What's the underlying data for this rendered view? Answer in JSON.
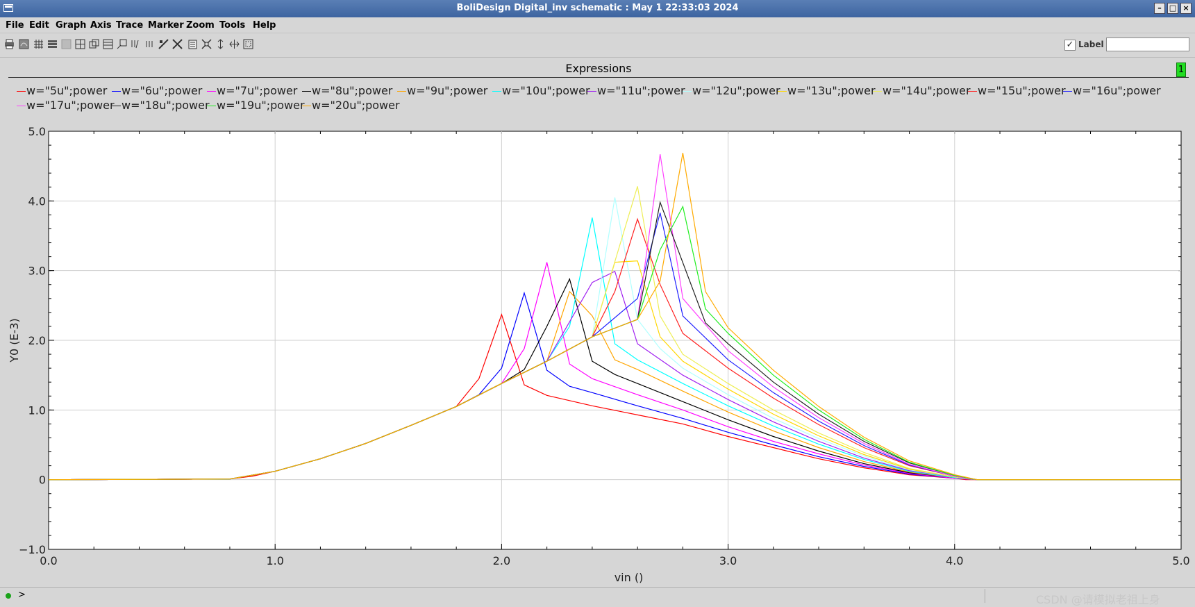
{
  "window": {
    "title": "BoliDesign Digital_inv schematic : May  1 22:33:03 2024",
    "minimize": "–",
    "maximize": "□",
    "close": "×"
  },
  "menubar": {
    "items": [
      "File",
      "Edit",
      "Graph",
      "Axis",
      "Trace",
      "Marker",
      "Zoom",
      "Tools",
      "Help"
    ]
  },
  "toolbar": {
    "icons": [
      "print-icon",
      "calculator-icon",
      "grid-icon",
      "strips-icon",
      "blank-icon",
      "split-icon",
      "overlay-icon",
      "stack-icon",
      "snap-icon",
      "text-icon",
      "columns-icon",
      "bar-icon",
      "fit-icon",
      "clipboard-icon",
      "zoom-fit-icon",
      "pan-icon",
      "move-icon",
      "zoom-box-icon"
    ],
    "label_checked": true,
    "label_text": "Label",
    "label_value": ""
  },
  "panel": {
    "title": "Expressions",
    "badge": "1"
  },
  "chart_data": {
    "type": "line",
    "xlabel": "vin ()",
    "ylabel": "Y0 (E-3)",
    "xlim": [
      0,
      5
    ],
    "ylim": [
      -1,
      5
    ],
    "xticks": [
      "0.0",
      "1.0",
      "2.0",
      "3.0",
      "4.0",
      "5.0"
    ],
    "yticks": [
      "−1.0",
      "0",
      "1.0",
      "2.0",
      "3.0",
      "4.0",
      "5.0"
    ],
    "grid": true,
    "legend_position": "top",
    "series": [
      {
        "name": "w=\"5u\";power",
        "color": "#ff0000",
        "x": [
          0,
          0.8,
          0.9,
          1.0,
          1.2,
          1.4,
          1.6,
          1.8,
          1.9,
          2.0,
          2.1,
          2.2,
          2.4,
          2.6,
          2.8,
          3.0,
          3.2,
          3.4,
          3.6,
          3.8,
          4.0,
          4.05,
          5.0
        ],
        "y": [
          0,
          0.01,
          0.05,
          0.12,
          0.3,
          0.52,
          0.78,
          1.05,
          1.45,
          2.37,
          1.36,
          1.21,
          1.06,
          0.93,
          0.8,
          0.62,
          0.46,
          0.3,
          0.17,
          0.07,
          0.02,
          0,
          0
        ]
      },
      {
        "name": "w=\"6u\";power",
        "color": "#0000ff",
        "x": [
          0,
          0.8,
          1.0,
          1.2,
          1.4,
          1.6,
          1.8,
          1.9,
          2.0,
          2.1,
          2.2,
          2.3,
          2.4,
          2.6,
          2.8,
          3.0,
          3.2,
          3.4,
          3.6,
          3.8,
          4.0,
          4.1,
          5.0
        ],
        "y": [
          0,
          0.01,
          0.12,
          0.3,
          0.52,
          0.78,
          1.05,
          1.22,
          1.6,
          2.68,
          1.57,
          1.34,
          1.25,
          1.06,
          0.88,
          0.68,
          0.5,
          0.33,
          0.19,
          0.08,
          0.02,
          0,
          0
        ]
      },
      {
        "name": "w=\"7u\";power",
        "color": "#ff00ff",
        "x": [
          0,
          0.8,
          1.0,
          1.2,
          1.4,
          1.6,
          1.8,
          2.0,
          2.1,
          2.2,
          2.3,
          2.4,
          2.6,
          2.8,
          3.0,
          3.2,
          3.4,
          3.6,
          3.8,
          4.0,
          4.1,
          5.0
        ],
        "y": [
          0,
          0.01,
          0.12,
          0.3,
          0.52,
          0.78,
          1.05,
          1.38,
          1.88,
          3.12,
          1.66,
          1.45,
          1.22,
          1.0,
          0.76,
          0.55,
          0.37,
          0.21,
          0.09,
          0.02,
          0,
          0
        ]
      },
      {
        "name": "w=\"8u\";power",
        "color": "#000000",
        "x": [
          0,
          0.8,
          1.0,
          1.2,
          1.4,
          1.6,
          1.8,
          2.0,
          2.1,
          2.2,
          2.3,
          2.4,
          2.5,
          2.6,
          2.8,
          3.0,
          3.2,
          3.4,
          3.6,
          3.8,
          4.0,
          4.1,
          5.0
        ],
        "y": [
          0,
          0.01,
          0.12,
          0.3,
          0.52,
          0.78,
          1.05,
          1.38,
          1.58,
          2.2,
          2.88,
          1.7,
          1.51,
          1.38,
          1.12,
          0.86,
          0.62,
          0.41,
          0.23,
          0.1,
          0.03,
          0,
          0
        ]
      },
      {
        "name": "w=\"9u\";power",
        "color": "#ffa500",
        "x": [
          0,
          0.8,
          1.0,
          1.2,
          1.4,
          1.6,
          1.8,
          2.0,
          2.2,
          2.3,
          2.4,
          2.5,
          2.6,
          2.8,
          3.0,
          3.2,
          3.4,
          3.6,
          3.8,
          4.0,
          4.1,
          5.0
        ],
        "y": [
          0,
          0.01,
          0.12,
          0.3,
          0.52,
          0.78,
          1.05,
          1.38,
          1.7,
          2.7,
          2.35,
          1.72,
          1.58,
          1.27,
          0.97,
          0.7,
          0.46,
          0.26,
          0.11,
          0.03,
          0,
          0
        ]
      },
      {
        "name": "w=\"10u\";power",
        "color": "#00ffff",
        "x": [
          0,
          0.8,
          1.0,
          1.2,
          1.4,
          1.6,
          1.8,
          2.0,
          2.2,
          2.3,
          2.4,
          2.5,
          2.6,
          2.8,
          3.0,
          3.2,
          3.4,
          3.6,
          3.8,
          4.0,
          4.1,
          5.0
        ],
        "y": [
          0,
          0.01,
          0.12,
          0.3,
          0.52,
          0.78,
          1.05,
          1.38,
          1.7,
          2.2,
          3.76,
          1.95,
          1.72,
          1.38,
          1.06,
          0.77,
          0.51,
          0.29,
          0.12,
          0.03,
          0,
          0
        ]
      },
      {
        "name": "w=\"11u\";power",
        "color": "#a020f0",
        "x": [
          0,
          0.8,
          1.0,
          1.2,
          1.4,
          1.6,
          1.8,
          2.0,
          2.2,
          2.4,
          2.5,
          2.6,
          2.8,
          3.0,
          3.2,
          3.4,
          3.6,
          3.8,
          4.0,
          4.1,
          5.0
        ],
        "y": [
          0,
          0.01,
          0.12,
          0.3,
          0.52,
          0.78,
          1.05,
          1.38,
          1.7,
          2.83,
          2.99,
          1.95,
          1.5,
          1.15,
          0.83,
          0.55,
          0.31,
          0.13,
          0.04,
          0,
          0
        ]
      },
      {
        "name": "w=\"12u\";power",
        "color": "#b0ffff",
        "x": [
          0,
          0.8,
          1.0,
          1.2,
          1.4,
          1.6,
          1.8,
          2.0,
          2.2,
          2.4,
          2.5,
          2.6,
          2.7,
          2.8,
          3.0,
          3.2,
          3.4,
          3.6,
          3.8,
          4.0,
          4.1,
          5.0
        ],
        "y": [
          0,
          0.01,
          0.12,
          0.3,
          0.52,
          0.78,
          1.05,
          1.38,
          1.7,
          2.05,
          4.05,
          2.3,
          1.88,
          1.6,
          1.22,
          0.88,
          0.59,
          0.34,
          0.14,
          0.04,
          0,
          0
        ]
      },
      {
        "name": "w=\"13u\";power",
        "color": "#ffd700",
        "x": [
          0,
          0.8,
          1.0,
          1.2,
          1.4,
          1.6,
          1.8,
          2.0,
          2.2,
          2.4,
          2.5,
          2.6,
          2.7,
          2.8,
          3.0,
          3.2,
          3.4,
          3.6,
          3.8,
          4.0,
          4.1,
          5.0
        ],
        "y": [
          0,
          0.01,
          0.12,
          0.3,
          0.52,
          0.78,
          1.05,
          1.38,
          1.7,
          2.05,
          3.12,
          3.14,
          2.05,
          1.7,
          1.3,
          0.94,
          0.63,
          0.36,
          0.15,
          0.04,
          0,
          0
        ]
      },
      {
        "name": "w=\"14u\";power",
        "color": "#eeee55",
        "x": [
          0,
          0.8,
          1.0,
          1.2,
          1.4,
          1.6,
          1.8,
          2.0,
          2.2,
          2.4,
          2.6,
          2.7,
          2.8,
          3.0,
          3.2,
          3.4,
          3.6,
          3.8,
          4.0,
          4.1,
          5.0
        ],
        "y": [
          0,
          0.01,
          0.12,
          0.3,
          0.52,
          0.78,
          1.05,
          1.38,
          1.7,
          2.05,
          4.21,
          2.35,
          1.8,
          1.38,
          1.0,
          0.67,
          0.39,
          0.16,
          0.04,
          0,
          0
        ]
      },
      {
        "name": "w=\"15u\";power",
        "color": "#ff2020",
        "x": [
          0,
          0.8,
          1.0,
          1.2,
          1.4,
          1.6,
          1.8,
          2.0,
          2.2,
          2.4,
          2.5,
          2.6,
          2.7,
          2.8,
          3.0,
          3.2,
          3.4,
          3.6,
          3.8,
          4.0,
          4.1,
          5.0
        ],
        "y": [
          0,
          0.01,
          0.12,
          0.3,
          0.52,
          0.78,
          1.05,
          1.38,
          1.7,
          2.05,
          2.7,
          3.74,
          2.8,
          2.1,
          1.6,
          1.17,
          0.79,
          0.46,
          0.2,
          0.05,
          0,
          0
        ]
      },
      {
        "name": "w=\"16u\";power",
        "color": "#2020ff",
        "x": [
          0,
          0.8,
          1.0,
          1.2,
          1.4,
          1.6,
          1.8,
          2.0,
          2.2,
          2.4,
          2.6,
          2.7,
          2.8,
          3.0,
          3.2,
          3.4,
          3.6,
          3.8,
          4.0,
          4.1,
          5.0
        ],
        "y": [
          0,
          0.01,
          0.12,
          0.3,
          0.52,
          0.78,
          1.05,
          1.38,
          1.7,
          2.05,
          2.6,
          3.83,
          2.35,
          1.72,
          1.25,
          0.84,
          0.49,
          0.21,
          0.05,
          0,
          0
        ]
      },
      {
        "name": "w=\"17u\";power",
        "color": "#ff40ff",
        "x": [
          0,
          0.8,
          1.0,
          1.2,
          1.4,
          1.6,
          1.8,
          2.0,
          2.2,
          2.4,
          2.6,
          2.7,
          2.8,
          3.0,
          3.2,
          3.4,
          3.6,
          3.8,
          4.0,
          4.1,
          5.0
        ],
        "y": [
          0,
          0.01,
          0.12,
          0.3,
          0.52,
          0.78,
          1.05,
          1.38,
          1.7,
          2.05,
          2.3,
          4.67,
          2.6,
          1.85,
          1.33,
          0.89,
          0.52,
          0.22,
          0.05,
          0,
          0
        ]
      },
      {
        "name": "w=\"18u\";power",
        "color": "#202020",
        "x": [
          0,
          0.8,
          1.0,
          1.2,
          1.4,
          1.6,
          1.8,
          2.0,
          2.2,
          2.4,
          2.6,
          2.7,
          2.9,
          3.0,
          3.2,
          3.4,
          3.6,
          3.8,
          4.0,
          4.1,
          5.0
        ],
        "y": [
          0,
          0.01,
          0.12,
          0.3,
          0.52,
          0.78,
          1.05,
          1.38,
          1.7,
          2.05,
          2.3,
          3.98,
          2.25,
          1.95,
          1.4,
          0.94,
          0.55,
          0.24,
          0.06,
          0,
          0
        ]
      },
      {
        "name": "w=\"19u\";power",
        "color": "#20ee20",
        "x": [
          0,
          0.8,
          1.0,
          1.2,
          1.4,
          1.6,
          1.8,
          2.0,
          2.2,
          2.4,
          2.6,
          2.7,
          2.8,
          2.9,
          3.0,
          3.2,
          3.4,
          3.6,
          3.8,
          4.0,
          4.1,
          5.0
        ],
        "y": [
          0,
          0.01,
          0.12,
          0.3,
          0.52,
          0.78,
          1.05,
          1.38,
          1.7,
          2.05,
          2.3,
          3.3,
          3.92,
          2.45,
          2.1,
          1.5,
          1.0,
          0.58,
          0.25,
          0.06,
          0,
          0
        ]
      },
      {
        "name": "w=\"20u\";power",
        "color": "#ffaa00",
        "x": [
          0,
          0.8,
          1.0,
          1.2,
          1.4,
          1.6,
          1.8,
          2.0,
          2.2,
          2.4,
          2.6,
          2.7,
          2.8,
          2.9,
          3.0,
          3.2,
          3.4,
          3.6,
          3.8,
          4.0,
          4.1,
          5.0
        ],
        "y": [
          0,
          0.01,
          0.12,
          0.3,
          0.52,
          0.78,
          1.05,
          1.38,
          1.7,
          2.05,
          2.3,
          2.85,
          4.69,
          2.7,
          2.18,
          1.57,
          1.05,
          0.61,
          0.27,
          0.07,
          0,
          0
        ]
      }
    ]
  },
  "statusbar": {
    "prompt": ">",
    "watermark": "CSDN @请模拟老祖上身"
  }
}
